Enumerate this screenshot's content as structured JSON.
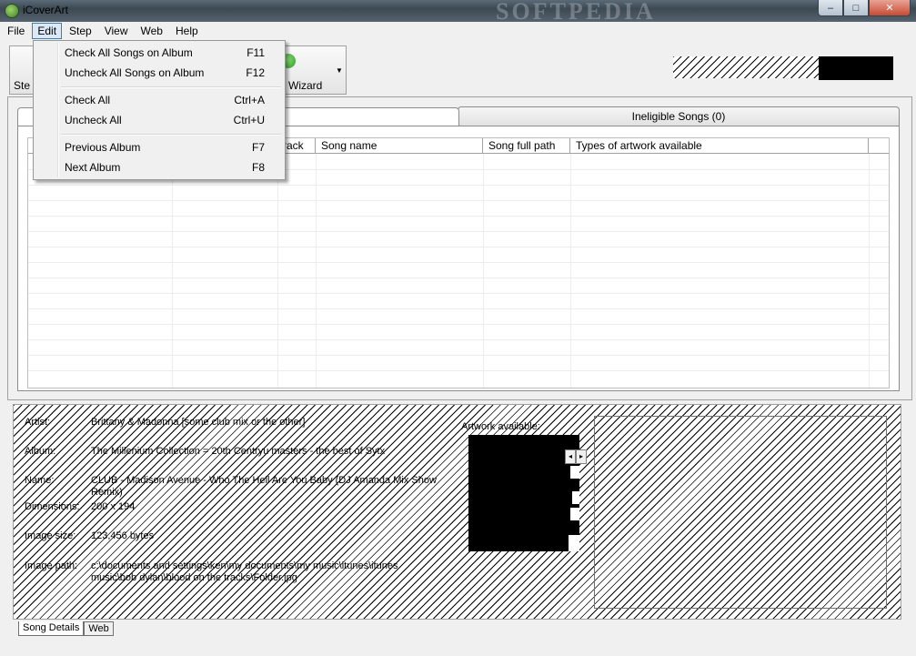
{
  "window": {
    "title": "iCoverArt",
    "watermark": "SOFTPEDIA",
    "minimize": "–",
    "maximize": "□",
    "close": "✕"
  },
  "menubar": {
    "items": [
      "File",
      "Edit",
      "Step",
      "View",
      "Web",
      "Help"
    ]
  },
  "toolbar": {
    "step_label": "Ste",
    "wizard_label": "n Wizard",
    "dropdown_arrow": "▼"
  },
  "tabs": {
    "ineligible": "Ineligible Songs (0)"
  },
  "grid": {
    "columns": [
      "rack",
      "Song name",
      "Song full path",
      "Types of artwork available"
    ]
  },
  "edit_menu": {
    "items": [
      {
        "label": "Check All Songs on Album",
        "shortcut": "F11"
      },
      {
        "label": "Uncheck All Songs on Album",
        "shortcut": "F12"
      },
      {
        "label": "Check All",
        "shortcut": "Ctrl+A"
      },
      {
        "label": "Uncheck All",
        "shortcut": "Ctrl+U"
      },
      {
        "label": "Previous Album",
        "shortcut": "F7"
      },
      {
        "label": "Next Album",
        "shortcut": "F8"
      }
    ]
  },
  "details": {
    "artist_label": "Artist:",
    "artist": "Brittany & Madonna [some club mix or the other]",
    "album_label": "Album:",
    "album": "The Millenium Collection = 20th Centryu masters - the best of Sytx",
    "name_label": "Name:",
    "name": "CLUB - Madison Avenue - Who The Hell Are You Baby (DJ Amanda Mix Show Remix)",
    "dimensions_label": "Dimensions:",
    "dimensions": "200 x 194",
    "image_size_label": "Image size:",
    "image_size": "123,456 bytes",
    "image_path_label": "Image path:",
    "image_path": "c:\\documents and settings\\ken\\my documents\\my music\\itunes\\itunes music\\bob dylan\\blood on the tracks\\Folder.jpg",
    "artwork_label": "Artwork available:",
    "prev": "◂",
    "next": "▸"
  },
  "bottom_tabs": [
    "Song Details",
    "Web"
  ]
}
